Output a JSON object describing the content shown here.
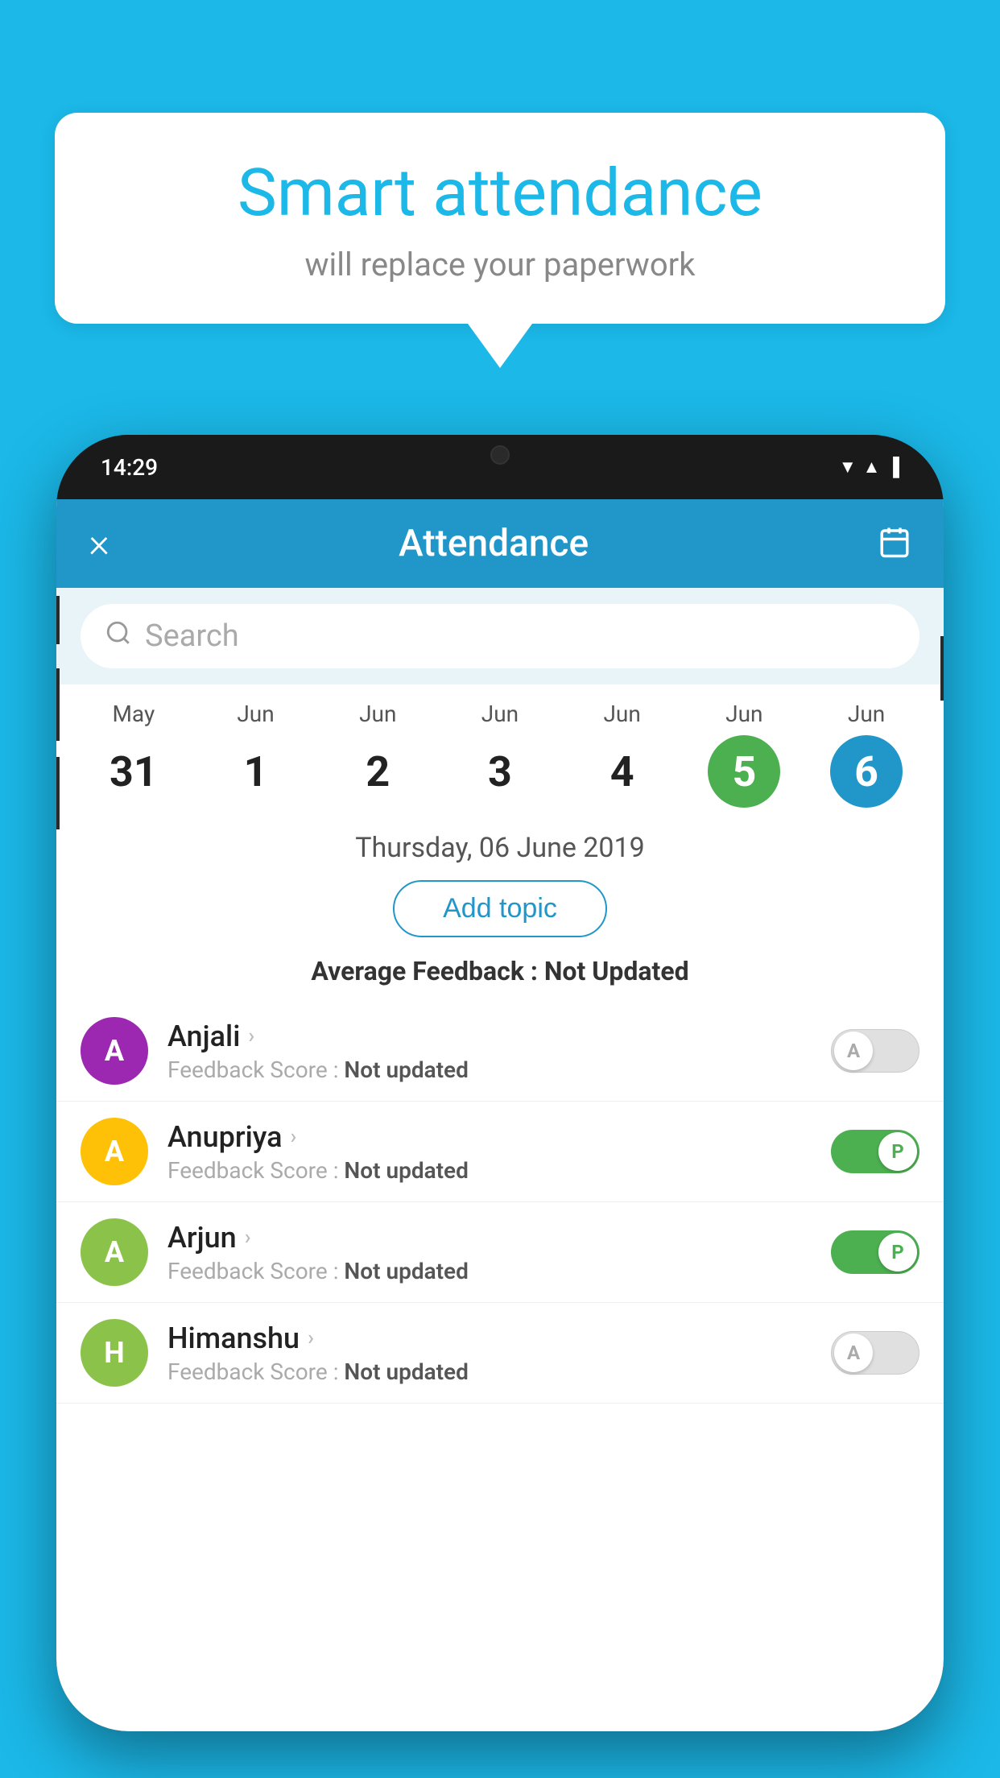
{
  "background_color": "#1BB8E8",
  "speech_bubble": {
    "title": "Smart attendance",
    "subtitle": "will replace your paperwork"
  },
  "phone": {
    "status_bar": {
      "time": "14:29",
      "icons": [
        "wifi",
        "signal",
        "battery"
      ]
    },
    "header": {
      "close_label": "×",
      "title": "Attendance",
      "calendar_icon": "calendar"
    },
    "search": {
      "placeholder": "Search"
    },
    "calendar": {
      "days": [
        {
          "month": "May",
          "date": "31",
          "state": "normal"
        },
        {
          "month": "Jun",
          "date": "1",
          "state": "normal"
        },
        {
          "month": "Jun",
          "date": "2",
          "state": "normal"
        },
        {
          "month": "Jun",
          "date": "3",
          "state": "normal"
        },
        {
          "month": "Jun",
          "date": "4",
          "state": "normal"
        },
        {
          "month": "Jun",
          "date": "5",
          "state": "today"
        },
        {
          "month": "Jun",
          "date": "6",
          "state": "selected"
        }
      ]
    },
    "selected_date": "Thursday, 06 June 2019",
    "add_topic_label": "Add topic",
    "avg_feedback_label": "Average Feedback :",
    "avg_feedback_value": "Not Updated",
    "students": [
      {
        "name": "Anjali",
        "avatar_letter": "A",
        "avatar_color": "#9C27B0",
        "feedback_label": "Feedback Score :",
        "feedback_value": "Not updated",
        "toggle_state": "off",
        "toggle_letter": "A"
      },
      {
        "name": "Anupriya",
        "avatar_letter": "A",
        "avatar_color": "#FFC107",
        "feedback_label": "Feedback Score :",
        "feedback_value": "Not updated",
        "toggle_state": "on",
        "toggle_letter": "P"
      },
      {
        "name": "Arjun",
        "avatar_letter": "A",
        "avatar_color": "#8BC34A",
        "feedback_label": "Feedback Score :",
        "feedback_value": "Not updated",
        "toggle_state": "on",
        "toggle_letter": "P"
      },
      {
        "name": "Himanshu",
        "avatar_letter": "H",
        "avatar_color": "#8BC34A",
        "feedback_label": "Feedback Score :",
        "feedback_value": "Not updated",
        "toggle_state": "off",
        "toggle_letter": "A"
      }
    ]
  }
}
